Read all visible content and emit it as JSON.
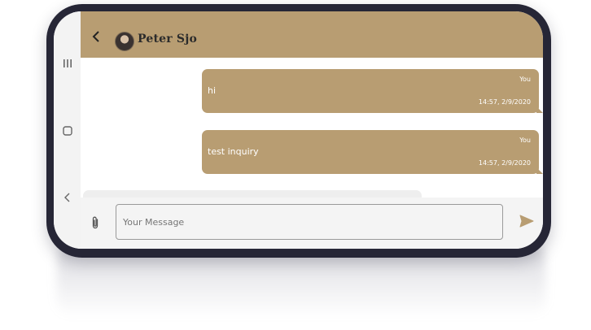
{
  "header": {
    "contact_name": "Peter Sjo"
  },
  "messages": [
    {
      "sender": "You",
      "text": "hi",
      "time": "14:57, 2/9/2020"
    },
    {
      "sender": "You",
      "text": "test inquiry",
      "time": "14:57, 2/9/2020"
    }
  ],
  "composer": {
    "placeholder": "Your Message"
  },
  "colors": {
    "accent": "#b89d72",
    "phone_frame": "#262636"
  },
  "icons": [
    "recent-apps-icon",
    "home-icon",
    "back-nav-icon",
    "back-arrow-icon",
    "attach-icon",
    "send-icon"
  ]
}
